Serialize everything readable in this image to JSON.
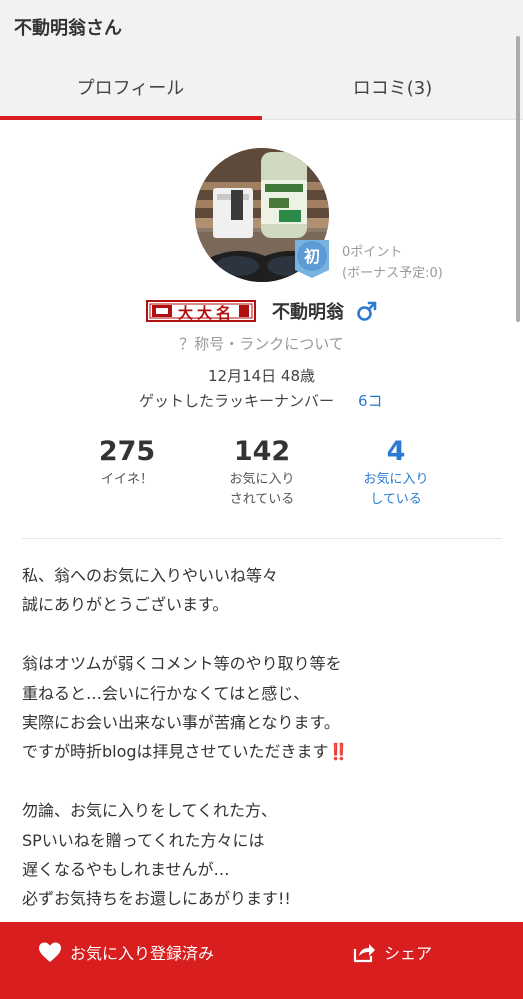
{
  "header": {
    "title": "不動明翁さん"
  },
  "tabs": [
    {
      "label": "プロフィール",
      "active": true
    },
    {
      "label": "ロコミ(3)",
      "active": false
    }
  ],
  "profile": {
    "badge": "初",
    "points": "0ポイント",
    "bonus": "(ボーナス予定:0)",
    "rank_title": "大大名",
    "name": "不動明翁",
    "gender_icon": "male-icon",
    "rank_link": "？称号・ランクについて",
    "birth_age": "12月14日 48歳",
    "lucky_label": "ゲットしたラッキーナンバー",
    "lucky_count": "6コ"
  },
  "stats": [
    {
      "value": "275",
      "label1": "イイネ！",
      "label2": ""
    },
    {
      "value": "142",
      "label1": "お気に入り",
      "label2": "されている"
    },
    {
      "value": "4",
      "label1": "お気に入り",
      "label2": "している"
    }
  ],
  "bio": {
    "lines": [
      "私、翁へのお気に入りやいいね等々",
      "誠にありがとうございます。",
      "",
      "翁はオツムが弱くコメント等のやり取り等を",
      "重ねると…会いに行かなくてはと感じ、",
      "実際にお会い出来ない事が苦痛となります。",
      "ですが時折blogは拝見させていただきます",
      "",
      "勿論、お気に入りをしてくれた方、",
      "SPいいねを贈ってくれた方々には",
      "遅くなるやもしれませんが…",
      "必ずお気持ちをお還しにあがります!!"
    ],
    "emoji_suffix": "‼️"
  },
  "footer": {
    "favorite_label": "お気に入り登録済み",
    "share_label": "シェア"
  },
  "colors": {
    "accent": "#d81e1e",
    "link": "#2a7ad2",
    "badge": "#7ab2e0"
  }
}
